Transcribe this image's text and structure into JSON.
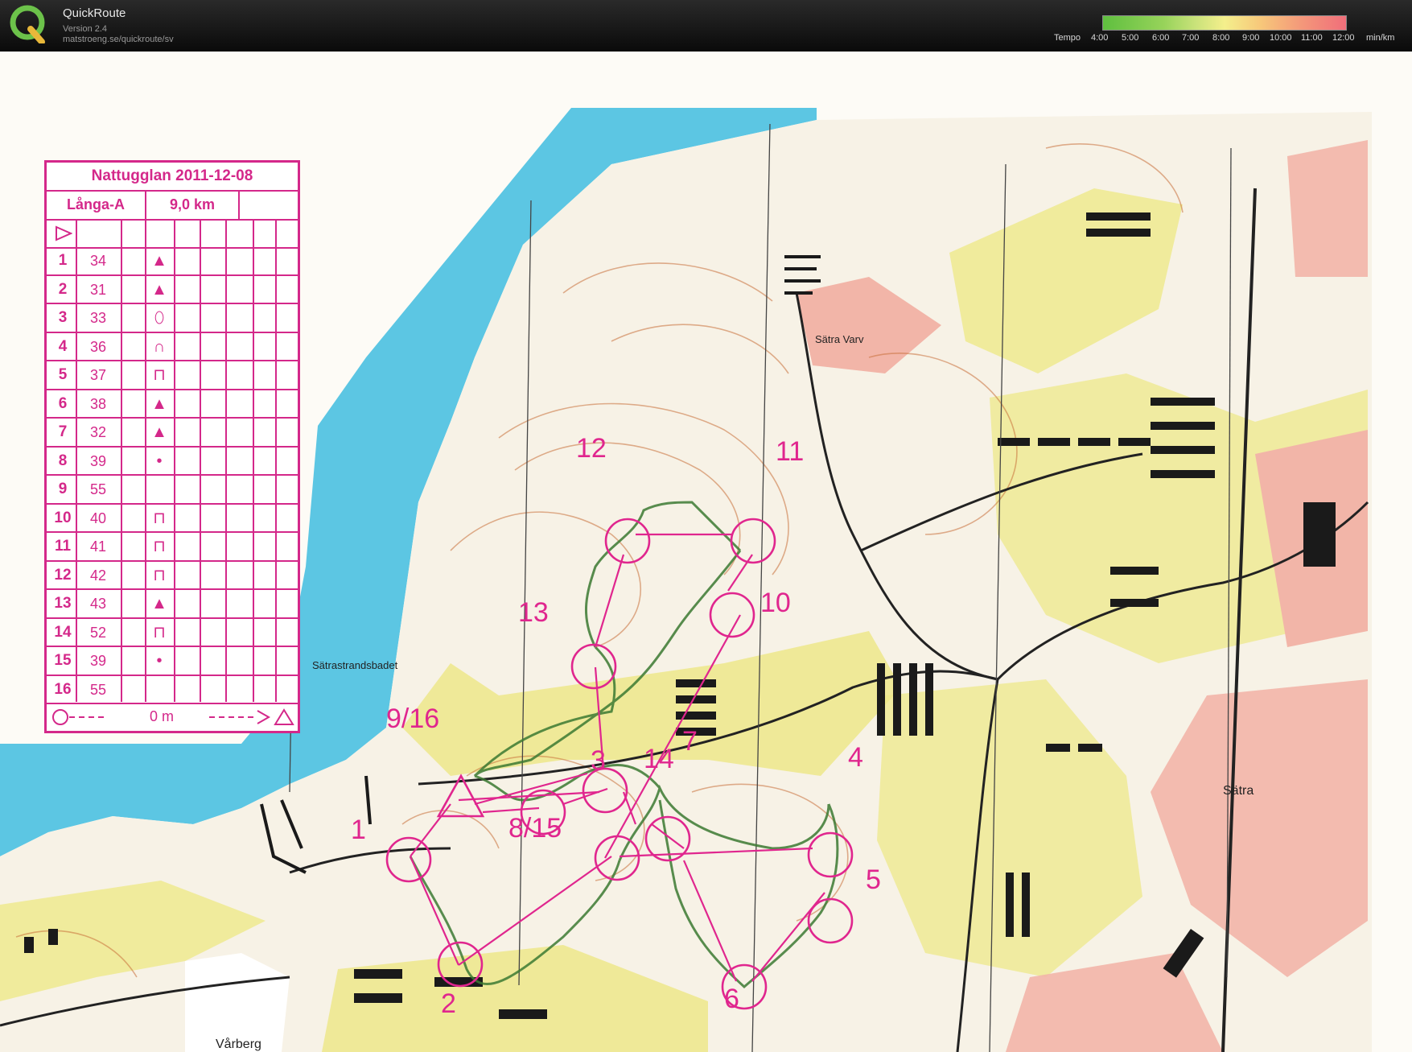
{
  "app": {
    "title": "QuickRoute",
    "version": "Version 2.4",
    "url": "matstroeng.se/quickroute/sv"
  },
  "legend": {
    "label": "Tempo",
    "ticks": [
      "4:00",
      "5:00",
      "6:00",
      "7:00",
      "8:00",
      "9:00",
      "10:00",
      "11:00",
      "12:00"
    ],
    "unit": "min/km"
  },
  "control_card": {
    "title": "Nattugglan 2011-12-08",
    "course": "Långa-A",
    "distance": "9,0 km",
    "rows": [
      {
        "num": "1",
        "code": "34",
        "symbol": "▲"
      },
      {
        "num": "2",
        "code": "31",
        "symbol": "▲"
      },
      {
        "num": "3",
        "code": "33",
        "symbol": "⬯"
      },
      {
        "num": "4",
        "code": "36",
        "symbol": "∩"
      },
      {
        "num": "5",
        "code": "37",
        "symbol": "⊓"
      },
      {
        "num": "6",
        "code": "38",
        "symbol": "▲"
      },
      {
        "num": "7",
        "code": "32",
        "symbol": "▲"
      },
      {
        "num": "8",
        "code": "39",
        "symbol": "•"
      },
      {
        "num": "9",
        "code": "55",
        "symbol": ""
      },
      {
        "num": "10",
        "code": "40",
        "symbol": "⊓"
      },
      {
        "num": "11",
        "code": "41",
        "symbol": "⊓"
      },
      {
        "num": "12",
        "code": "42",
        "symbol": "⊓"
      },
      {
        "num": "13",
        "code": "43",
        "symbol": "▲"
      },
      {
        "num": "14",
        "code": "52",
        "symbol": "⊓"
      },
      {
        "num": "15",
        "code": "39",
        "symbol": "•"
      },
      {
        "num": "16",
        "code": "55",
        "symbol": ""
      }
    ],
    "finish_distance": "0 m"
  },
  "places": {
    "satra_varv": "Sätra Varv",
    "satrastrandsbadet": "Sätrastrandsbadet",
    "satra": "Sätra",
    "varberg": "Vårberg"
  },
  "control_labels": {
    "c1": "1",
    "c2": "2",
    "c3": "3",
    "c4": "4",
    "c5": "5",
    "c6": "6",
    "c7": "7",
    "c815": "8/15",
    "c916": "9/16",
    "c10": "10",
    "c11": "11",
    "c12": "12",
    "c13": "13",
    "c14": "14"
  },
  "colors": {
    "water": "#5cc6e3",
    "forest": "#f7f2e6",
    "open_land": "#ede88a",
    "urban": "#f2b5a8",
    "course": "#e0268e",
    "route": "#3c7a32",
    "contour": "#c8703a"
  }
}
